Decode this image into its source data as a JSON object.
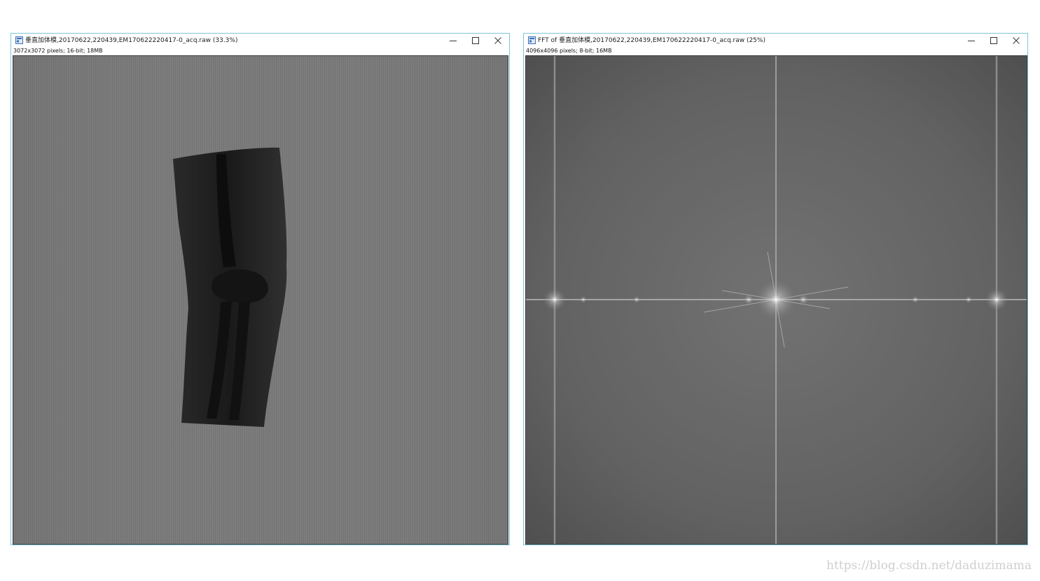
{
  "windows": [
    {
      "title": "垂直加体模,20170622,220439,EM170622220417-0_acq.raw (33.3%)",
      "info": "3072x3072 pixels; 16-bit; 18MB",
      "image": "x-ray-elbow-radiograph"
    },
    {
      "title": "FFT of 垂直加体模,20170622,220439,EM170622220417-0_acq.raw (25%)",
      "info": "4096x4096 pixels; 8-bit; 16MB",
      "image": "fft-power-spectrum"
    }
  ],
  "controls": {
    "minimize": "minimize-icon",
    "maximize": "maximize-icon",
    "close": "close-icon"
  },
  "watermark": "https://blog.csdn.net/daduzimama",
  "colors": {
    "window_border": "#7fc4d6",
    "xray_background": "#7b7b7b",
    "fft_background": "#5b5b5b"
  }
}
